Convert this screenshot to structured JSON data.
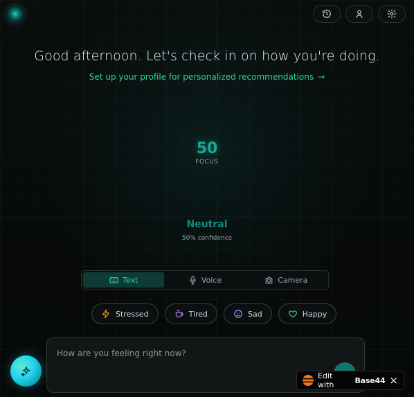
{
  "header": {
    "buttons": [
      {
        "name": "history-button",
        "icon": "history-icon"
      },
      {
        "name": "profile-button",
        "icon": "user-icon"
      },
      {
        "name": "settings-button",
        "icon": "gear-icon"
      }
    ]
  },
  "greeting": "Good afternoon. Let's check in on how you're doing.",
  "setup_link": {
    "label": "Set up your profile for personalized recommendations",
    "arrow_icon": "arrow-right-icon"
  },
  "focus": {
    "score": "50",
    "label": "FOCUS"
  },
  "mood": {
    "label": "Neutral",
    "confidence": "50% confidence"
  },
  "mode_tabs": [
    {
      "label": "Text",
      "icon": "keyboard-icon",
      "active": true
    },
    {
      "label": "Voice",
      "icon": "microphone-icon",
      "active": false
    },
    {
      "label": "Camera",
      "icon": "camera-icon",
      "active": false
    }
  ],
  "quick_moods": [
    {
      "label": "Stressed",
      "icon": "lightning-icon",
      "color": "#f59e0b"
    },
    {
      "label": "Tired",
      "icon": "coffee-icon",
      "color": "#c084fc"
    },
    {
      "label": "Sad",
      "icon": "sad-face-icon",
      "color": "#a78bfa"
    },
    {
      "label": "Happy",
      "icon": "heart-icon",
      "color": "#34d399"
    }
  ],
  "input": {
    "placeholder": "How are you feeling right now?",
    "value": ""
  },
  "badge": {
    "prefix": "Edit with",
    "brand": "Base44",
    "close": "×"
  },
  "colors": {
    "accent": "#2dd4bf",
    "active_tab_bg": "#0f3b36"
  }
}
